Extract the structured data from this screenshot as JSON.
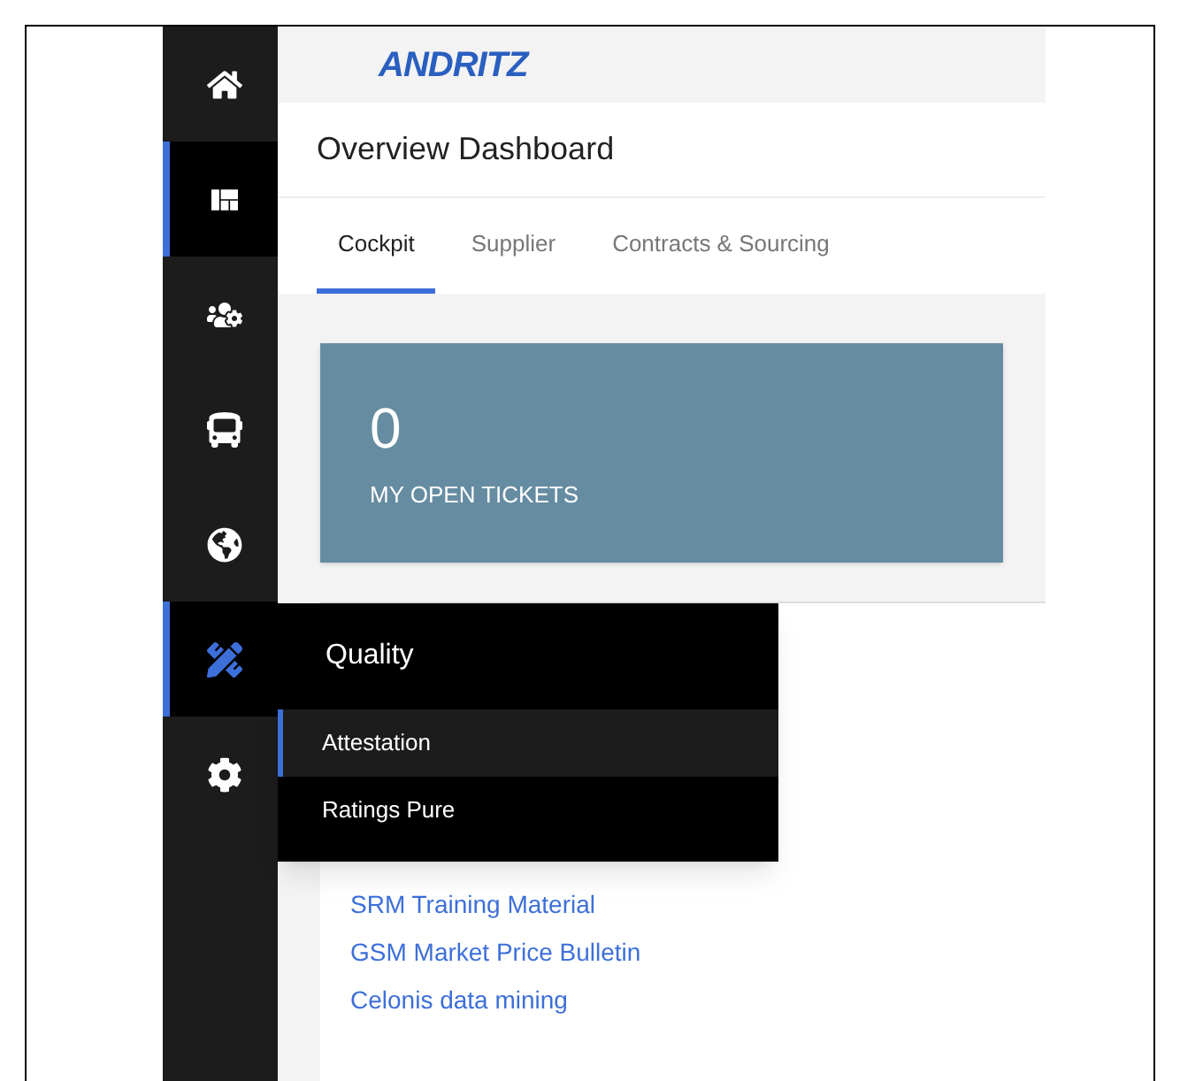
{
  "sidebar": {
    "items": [
      {
        "selected": false
      },
      {
        "selected": true
      },
      {
        "selected": false
      },
      {
        "selected": false
      },
      {
        "selected": false
      },
      {
        "selected": true
      },
      {
        "selected": false
      }
    ]
  },
  "header": {
    "logo": "ANDRITZ"
  },
  "page_title": "Overview Dashboard",
  "tabs": [
    {
      "label": "Cockpit",
      "selected": true
    },
    {
      "label": "Supplier",
      "selected": false
    },
    {
      "label": "Contracts & Sourcing",
      "selected": false
    }
  ],
  "tickets_card": {
    "value": "0",
    "label": "MY OPEN TICKETS"
  },
  "links": [
    "SRM Training Material",
    "GSM Market Price Bulletin",
    "Celonis data mining"
  ],
  "flyout": {
    "title": "Quality",
    "items": [
      {
        "label": "Attestation",
        "selected": true
      },
      {
        "label": "Ratings Pure",
        "selected": false
      }
    ]
  }
}
